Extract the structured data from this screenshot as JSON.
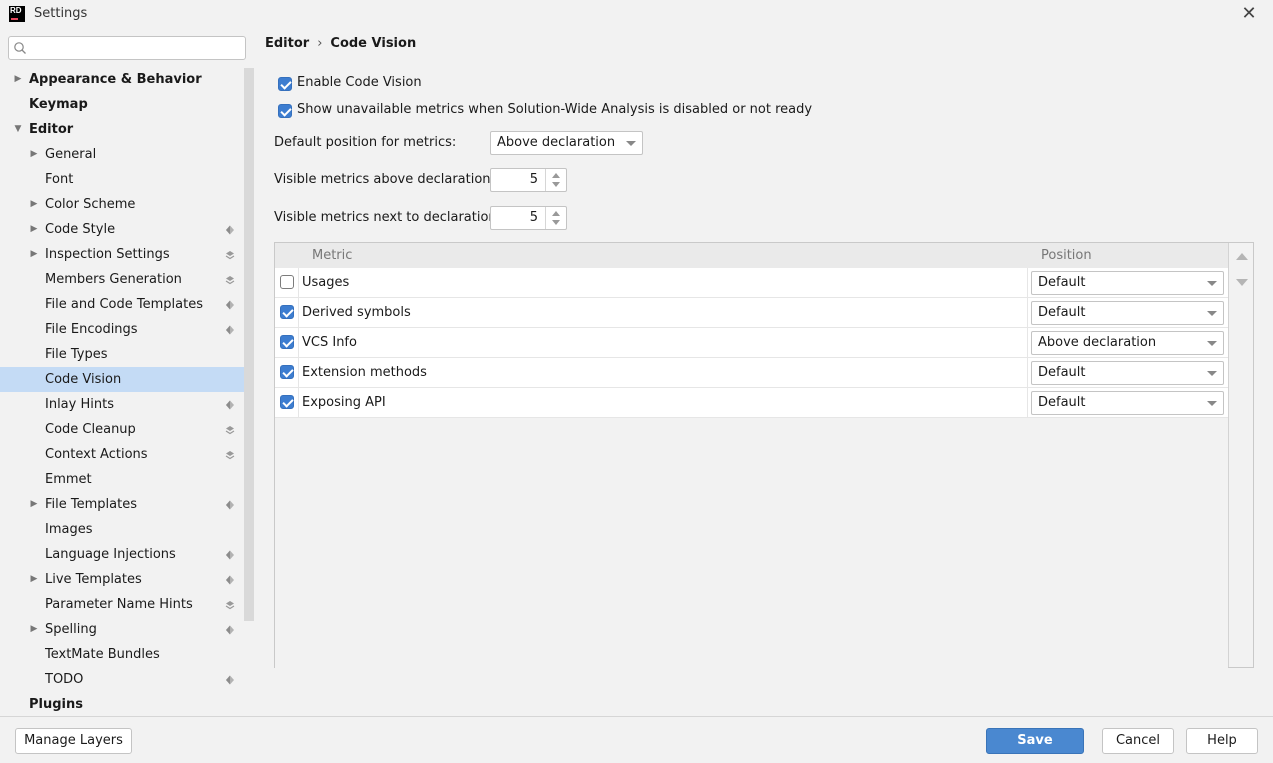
{
  "window": {
    "title": "Settings",
    "logo_text": "RD"
  },
  "search": {
    "placeholder": ""
  },
  "sidebar": {
    "items": [
      {
        "label": "Appearance & Behavior",
        "level": 0,
        "arrow": "right",
        "bold": true
      },
      {
        "label": "Keymap",
        "level": 0,
        "arrow": "",
        "bold": true
      },
      {
        "label": "Editor",
        "level": 0,
        "arrow": "down",
        "bold": true
      },
      {
        "label": "General",
        "level": 1,
        "arrow": "right"
      },
      {
        "label": "Font",
        "level": 1,
        "arrow": ""
      },
      {
        "label": "Color Scheme",
        "level": 1,
        "arrow": "right"
      },
      {
        "label": "Code Style",
        "level": 1,
        "arrow": "right",
        "icon": "project-icon"
      },
      {
        "label": "Inspection Settings",
        "level": 1,
        "arrow": "right",
        "icon": "layers-icon"
      },
      {
        "label": "Members Generation",
        "level": 1,
        "arrow": "",
        "icon": "layers-icon"
      },
      {
        "label": "File and Code Templates",
        "level": 1,
        "arrow": "",
        "icon": "project-icon"
      },
      {
        "label": "File Encodings",
        "level": 1,
        "arrow": "",
        "icon": "project-icon"
      },
      {
        "label": "File Types",
        "level": 1,
        "arrow": ""
      },
      {
        "label": "Code Vision",
        "level": 1,
        "arrow": "",
        "selected": true
      },
      {
        "label": "Inlay Hints",
        "level": 1,
        "arrow": "",
        "icon": "project-icon"
      },
      {
        "label": "Code Cleanup",
        "level": 1,
        "arrow": "",
        "icon": "layers-icon"
      },
      {
        "label": "Context Actions",
        "level": 1,
        "arrow": "",
        "icon": "layers-icon"
      },
      {
        "label": "Emmet",
        "level": 1,
        "arrow": ""
      },
      {
        "label": "File Templates",
        "level": 1,
        "arrow": "right",
        "icon": "project-icon"
      },
      {
        "label": "Images",
        "level": 1,
        "arrow": ""
      },
      {
        "label": "Language Injections",
        "level": 1,
        "arrow": "",
        "icon": "project-icon"
      },
      {
        "label": "Live Templates",
        "level": 1,
        "arrow": "right",
        "icon": "project-icon"
      },
      {
        "label": "Parameter Name Hints",
        "level": 1,
        "arrow": "",
        "icon": "layers-icon"
      },
      {
        "label": "Spelling",
        "level": 1,
        "arrow": "right",
        "icon": "project-icon"
      },
      {
        "label": "TextMate Bundles",
        "level": 1,
        "arrow": ""
      },
      {
        "label": "TODO",
        "level": 1,
        "arrow": "",
        "icon": "project-icon"
      },
      {
        "label": "Plugins",
        "level": 0,
        "arrow": "",
        "bold": true
      }
    ]
  },
  "breadcrumb": {
    "parent": "Editor",
    "separator": "›",
    "current": "Code Vision"
  },
  "options": {
    "enable_code_vision": {
      "label": "Enable Code Vision",
      "checked": true
    },
    "show_unavailable": {
      "label": "Show unavailable metrics when Solution-Wide Analysis is disabled or not ready",
      "checked": true
    },
    "default_position": {
      "label": "Default position for metrics:",
      "value": "Above declaration"
    },
    "visible_above": {
      "label": "Visible metrics above declaration:",
      "value": "5"
    },
    "visible_next": {
      "label": "Visible metrics next to declaration:",
      "value": "5"
    }
  },
  "table": {
    "headers": {
      "metric": "Metric",
      "position": "Position"
    },
    "rows": [
      {
        "name": "Usages",
        "checked": false,
        "position": "Default"
      },
      {
        "name": "Derived symbols",
        "checked": true,
        "position": "Default"
      },
      {
        "name": "VCS Info",
        "checked": true,
        "position": "Above declaration"
      },
      {
        "name": "Extension methods",
        "checked": true,
        "position": "Default"
      },
      {
        "name": "Exposing API",
        "checked": true,
        "position": "Default"
      }
    ]
  },
  "footer": {
    "manage_layers": "Manage Layers",
    "save": "Save",
    "cancel": "Cancel",
    "help": "Help"
  },
  "colors": {
    "accent": "#4a88d0",
    "selection": "#c4dbf5",
    "checkbox": "#3d7dd0"
  }
}
